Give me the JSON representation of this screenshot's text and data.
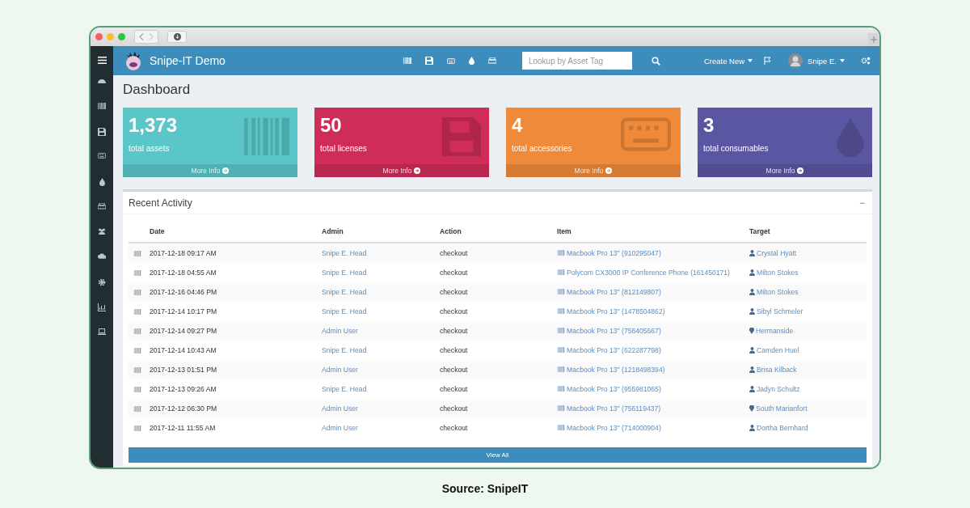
{
  "app": {
    "title": "Snipe-IT Demo"
  },
  "header": {
    "search": {
      "placeholder": "Lookup by Asset Tag"
    },
    "create_new": "Create New",
    "user": "Snipe E."
  },
  "page_title": "Dashboard",
  "cards": [
    {
      "kind": "assets",
      "count": "1,373",
      "label": "total assets",
      "link": "More Info",
      "color": "#5bc6c7"
    },
    {
      "kind": "licenses",
      "count": "50",
      "label": "total licenses",
      "link": "More Info",
      "color": "#cf2c5a"
    },
    {
      "kind": "accessories",
      "count": "4",
      "label": "total accessories",
      "link": "More Info",
      "color": "#ef8a3a"
    },
    {
      "kind": "consumables",
      "count": "3",
      "label": "total consumables",
      "link": "More Info",
      "color": "#5b56a2"
    }
  ],
  "recent_activity": {
    "title": "Recent Activity",
    "collapse": "−",
    "columns": [
      "Date",
      "Admin",
      "Action",
      "Item",
      "Target"
    ],
    "rows": [
      {
        "date": "2017-12-18 09:17 AM",
        "admin": "Snipe E. Head",
        "action": "checkout",
        "item": "Macbook Pro 13\" (910295047)",
        "target": "Crystal Hyatt",
        "kind": "user"
      },
      {
        "date": "2017-12-18 04:55 AM",
        "admin": "Snipe E. Head",
        "action": "checkout",
        "item": "Polycom CX3000 IP Conference Phone (161450171)",
        "target": "Milton Stokes",
        "kind": "user"
      },
      {
        "date": "2017-12-16 04:46 PM",
        "admin": "Snipe E. Head",
        "action": "checkout",
        "item": "Macbook Pro 13\" (812149807)",
        "target": "Milton Stokes",
        "kind": "user"
      },
      {
        "date": "2017-12-14 10:17 PM",
        "admin": "Snipe E. Head",
        "action": "checkout",
        "item": "Macbook Pro 13\" (1478504862)",
        "target": "Sibyl Schmeler",
        "kind": "user"
      },
      {
        "date": "2017-12-14 09:27 PM",
        "admin": "Admin User",
        "action": "checkout",
        "item": "Macbook Pro 13\" (756405667)",
        "target": "Hermanside",
        "kind": "location"
      },
      {
        "date": "2017-12-14 10:43 AM",
        "admin": "Snipe E. Head",
        "action": "checkout",
        "item": "Macbook Pro 13\" (622287798)",
        "target": "Camden Huel",
        "kind": "user"
      },
      {
        "date": "2017-12-13 01:51 PM",
        "admin": "Admin User",
        "action": "checkout",
        "item": "Macbook Pro 13\" (1218498394)",
        "target": "Brisa Kilback",
        "kind": "user"
      },
      {
        "date": "2017-12-13 09:26 AM",
        "admin": "Snipe E. Head",
        "action": "checkout",
        "item": "Macbook Pro 13\" (955981065)",
        "target": "Jadyn Schultz",
        "kind": "user"
      },
      {
        "date": "2017-12-12 06:30 PM",
        "admin": "Admin User",
        "action": "checkout",
        "item": "Macbook Pro 13\" (756119437)",
        "target": "South Marianfort",
        "kind": "location"
      },
      {
        "date": "2017-12-11 11:55 AM",
        "admin": "Admin User",
        "action": "checkout",
        "item": "Macbook Pro 13\" (714000904)",
        "target": "Dortha Bernhard",
        "kind": "user"
      }
    ],
    "view_all": "View All"
  },
  "caption": "Source: SnipeIT"
}
